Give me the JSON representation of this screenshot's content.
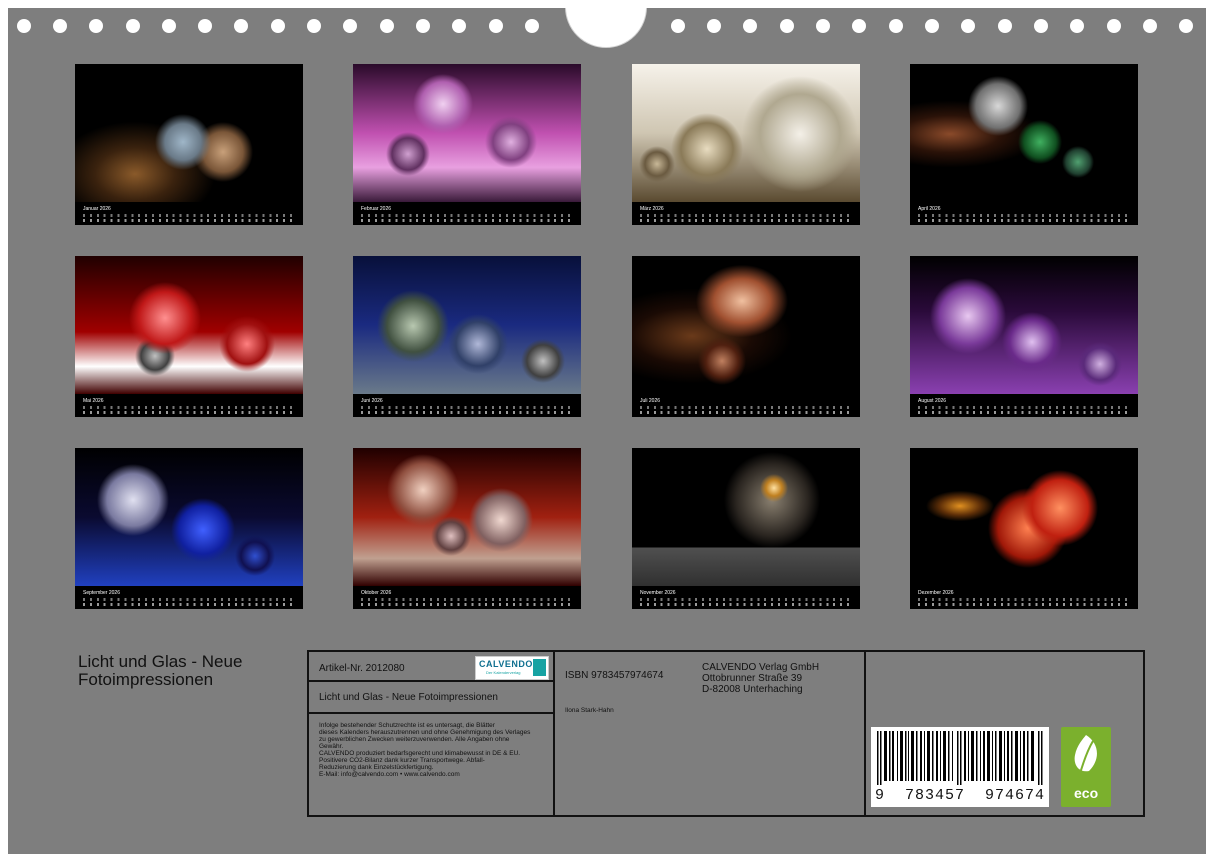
{
  "calendar": {
    "thumbnails": [
      {
        "month": "Januar",
        "year": "2026"
      },
      {
        "month": "Februar",
        "year": "2026"
      },
      {
        "month": "März",
        "year": "2026"
      },
      {
        "month": "April",
        "year": "2026"
      },
      {
        "month": "Mai",
        "year": "2026"
      },
      {
        "month": "Juni",
        "year": "2026"
      },
      {
        "month": "Juli",
        "year": "2026"
      },
      {
        "month": "August",
        "year": "2026"
      },
      {
        "month": "September",
        "year": "2026"
      },
      {
        "month": "Oktober",
        "year": "2026"
      },
      {
        "month": "November",
        "year": "2026"
      },
      {
        "month": "Dezember",
        "year": "2026"
      }
    ]
  },
  "title": {
    "line1": "Licht und Glas - Neue",
    "line2": "Fotoimpressionen"
  },
  "info": {
    "article": "Artikel-Nr. 2012080",
    "calvendo_logo_text": "CALVENDO",
    "calvendo_logo_sub": "Der Kalenderverlag",
    "subtitle": "Licht und Glas - Neue Fotoimpressionen",
    "legal": [
      "Infolge bestehender Schutzrechte ist es untersagt, die Blätter",
      "dieses Kalenders herauszutrennen und ohne Genehmigung des Verlages",
      "zu gewerblichen Zwecken weiterzuverwenden. Alle Angaben ohne",
      "Gewähr.",
      "CALVENDO produziert bedarfsgerecht und klimabewusst in DE & EU.",
      "Positivere CO2-Bilanz dank kurzer Transportwege. Abfall-",
      "Reduzierung dank Einzelstückfertigung.",
      "E-Mail: info@calvendo.com • www.calvendo.com"
    ],
    "isbn": "ISBN 9783457974674",
    "author": "Ilona Stark-Hahn",
    "publisher": [
      "CALVENDO Verlag GmbH",
      "Ottobrunner Straße 39",
      "D-82008 Unterhaching"
    ],
    "barcode_digits": "9  783457  974674",
    "eco_label": "eco"
  },
  "colors": {
    "background": "#7e7e7e",
    "eco_green": "#7bb02d",
    "calvendo_teal": "#17a3a3"
  }
}
